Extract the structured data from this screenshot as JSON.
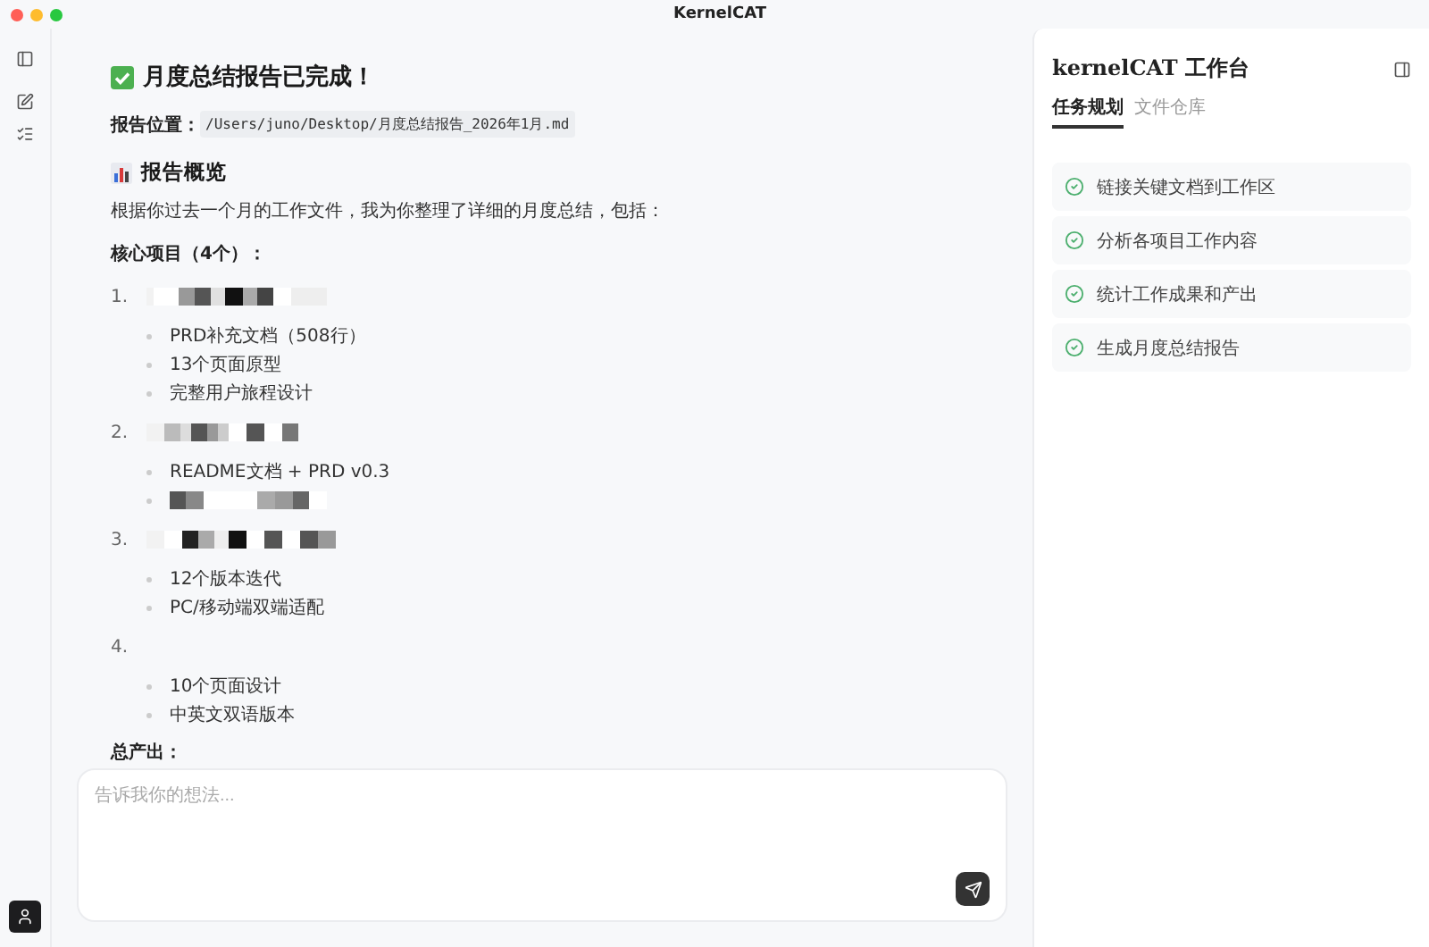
{
  "window": {
    "title": "KernelCAT"
  },
  "report": {
    "heading": "月度总结报告已完成！",
    "location_label": "报告位置：",
    "location_path": "/Users/juno/Desktop/月度总结报告_2026年1月.md",
    "overview_heading": "报告概览",
    "intro": "根据你过去一个月的工作文件，我为你整理了详细的月度总结，包括：",
    "projects_label": "核心项目（4个）：",
    "projects": [
      {
        "number": "1.",
        "items": [
          {
            "kind": "text",
            "text": "PRD补充文档（508行）"
          },
          {
            "kind": "text",
            "text": "13个页面原型"
          },
          {
            "kind": "text",
            "text": "完整用户旅程设计"
          }
        ]
      },
      {
        "number": "2.",
        "items": [
          {
            "kind": "text",
            "text": "README文档 + PRD v0.3"
          },
          {
            "kind": "redacted"
          }
        ]
      },
      {
        "number": "3.",
        "items": [
          {
            "kind": "text",
            "text": "12个版本迭代"
          },
          {
            "kind": "text",
            "text": "PC/移动端双端适配"
          }
        ]
      },
      {
        "number": "4.",
        "items": [
          {
            "kind": "text",
            "text": "10个页面设计"
          },
          {
            "kind": "text",
            "text": "中英文双语版本"
          }
        ]
      }
    ],
    "output_label": "总产出："
  },
  "chat": {
    "placeholder": "告诉我你的想法..."
  },
  "workspace": {
    "title": "kernelCAT 工作台",
    "tabs": [
      {
        "label": "任务规划",
        "selected": true
      },
      {
        "label": "文件仓库",
        "selected": false
      }
    ],
    "tasks": [
      {
        "label": "链接关键文档到工作区",
        "done": true
      },
      {
        "label": "分析各项目工作内容",
        "done": true
      },
      {
        "label": "统计工作成果和产出",
        "done": true
      },
      {
        "label": "生成月度总结报告",
        "done": true
      }
    ]
  }
}
